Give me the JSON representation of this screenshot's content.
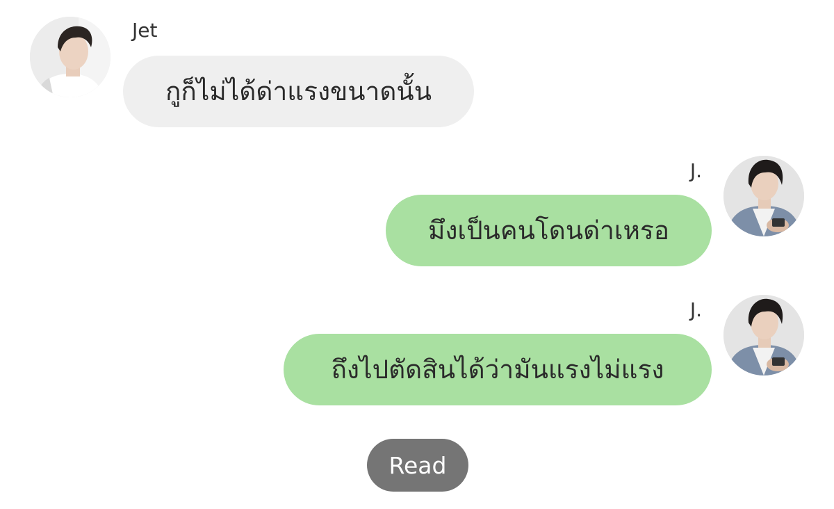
{
  "messages": [
    {
      "direction": "incoming",
      "sender": "Jet",
      "text": "กูก็ไม่ได้ด่าแรงขนาดนั้น",
      "avatar": "jet-avatar"
    },
    {
      "direction": "outgoing",
      "sender": "J.",
      "text": "มึงเป็นคนโดนด่าเหรอ",
      "avatar": "j-avatar"
    },
    {
      "direction": "outgoing",
      "sender": "J.",
      "text": "ถึงไปตัดสินได้ว่ามันแรงไม่แรง",
      "avatar": "j-avatar"
    }
  ],
  "status": {
    "read_label": "Read"
  },
  "colors": {
    "incoming_bubble": "#efefef",
    "outgoing_bubble": "#a9e0a1",
    "read_pill": "#757575"
  }
}
